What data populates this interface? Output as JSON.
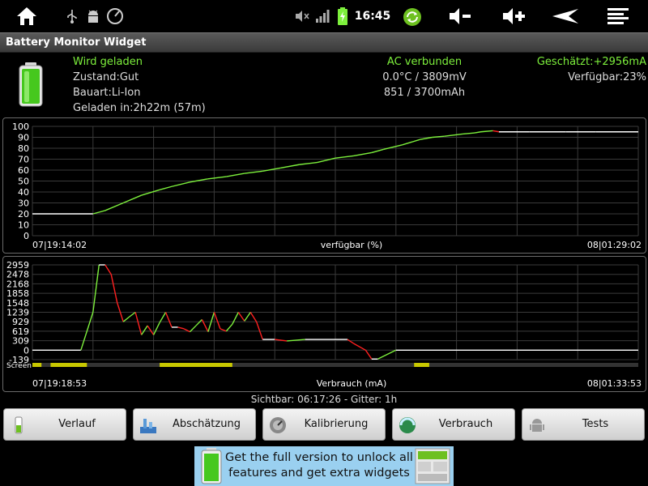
{
  "statusbar": {
    "time": "16:45"
  },
  "app": {
    "title": "Battery Monitor Widget"
  },
  "info": {
    "charging_status": "Wird geladen",
    "health": "Zustand:Gut",
    "type": "Bauart:Li-Ion",
    "charged_in": "Geladen in:2h22m (57m)",
    "ac_status": "AC verbunden",
    "temp_voltage": "0.0°C / 3809mV",
    "capacity": "851 / 3700mAh",
    "estimated": "Geschätzt:+2956mA",
    "available": "Verfügbar:23%"
  },
  "colors": {
    "accent": "#7df03c",
    "down": "#ff2020",
    "flat": "#ffffff",
    "screen_on": "#c8c800"
  },
  "chart_data": [
    {
      "type": "line",
      "title": "",
      "xlabel": "verfügbar (%)",
      "ylabel": "",
      "start_label": "07|19:14:02",
      "end_label": "08|01:29:02",
      "yticks": [
        "0",
        "10",
        "20",
        "30",
        "40",
        "50",
        "60",
        "70",
        "80",
        "90",
        "100"
      ],
      "ylim": [
        0,
        100
      ],
      "xlim": [
        0,
        100
      ],
      "x": [
        0,
        10,
        12,
        15,
        18,
        21,
        23,
        26,
        29,
        32,
        35,
        38,
        41,
        44,
        47,
        50,
        53,
        56,
        58,
        61,
        64,
        66,
        68,
        71,
        73,
        74,
        76,
        77,
        82,
        88,
        93,
        100
      ],
      "y": [
        20,
        20,
        23,
        30,
        37,
        42,
        45,
        49,
        52,
        54,
        57,
        59,
        62,
        65,
        67,
        71,
        73,
        76,
        79,
        83,
        88,
        90,
        91,
        93,
        94,
        95,
        96,
        95,
        95,
        95,
        95,
        95
      ]
    },
    {
      "type": "line",
      "title": "",
      "xlabel": "Verbrauch (mA)",
      "ylabel": "",
      "start_label": "07|19:18:53",
      "end_label": "08|01:33:53",
      "yticks": [
        "-139",
        "0",
        "309",
        "619",
        "929",
        "1239",
        "1548",
        "1858",
        "2168",
        "2478",
        "2959"
      ],
      "ylim": [
        -139,
        2959
      ],
      "xlim": [
        0,
        100
      ],
      "x": [
        0,
        8,
        10,
        11,
        12,
        13,
        14,
        15,
        16,
        17,
        18,
        19,
        20,
        21,
        22,
        23,
        24,
        25,
        26,
        27,
        28,
        29,
        30,
        31,
        32,
        33,
        34,
        35,
        36,
        37,
        38,
        40,
        42,
        45,
        50,
        52,
        53,
        55,
        56,
        57,
        60,
        80,
        100
      ],
      "y": [
        0,
        0,
        1239,
        2959,
        2959,
        2478,
        1548,
        929,
        1090,
        1239,
        500,
        800,
        500,
        900,
        1239,
        750,
        750,
        700,
        600,
        800,
        1000,
        600,
        1239,
        700,
        620,
        850,
        1239,
        950,
        1239,
        920,
        350,
        350,
        300,
        350,
        350,
        350,
        220,
        0,
        -130,
        -130,
        0,
        0,
        0
      ],
      "screen_bar": {
        "label": "Screen",
        "on_segments": [
          [
            0,
            1.5
          ],
          [
            3,
            9
          ],
          [
            21,
            33
          ],
          [
            63,
            65.5
          ]
        ]
      }
    }
  ],
  "gridinfo": "Sichtbar: 06:17:26 - Gitter: 1h",
  "buttons": [
    "Verlauf",
    "Abschätzung",
    "Kalibrierung",
    "Verbrauch",
    "Tests"
  ],
  "ad": {
    "text": "Get the full version to unlock all features and get extra widgets"
  }
}
